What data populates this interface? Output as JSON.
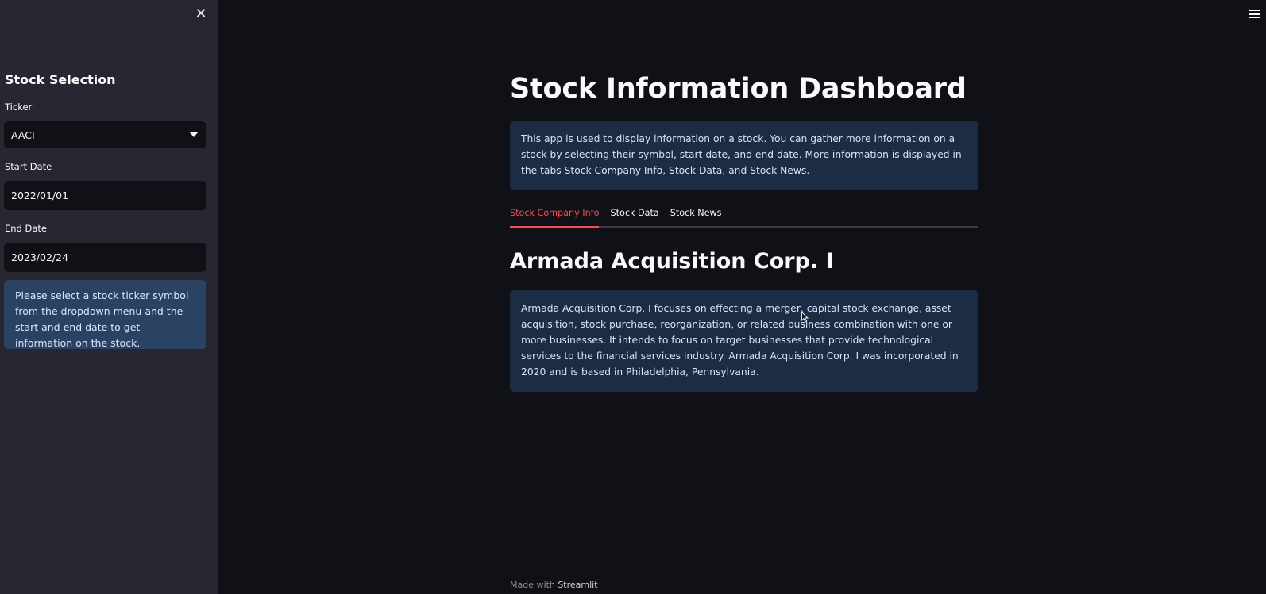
{
  "sidebar": {
    "title": "Stock Selection",
    "ticker_label": "Ticker",
    "ticker_value": "AACI",
    "start_label": "Start Date",
    "start_value": "2022/01/01",
    "end_label": "End Date",
    "end_value": "2023/02/24",
    "info": "Please select a stock ticker symbol from the dropdown menu and the start and end date to get information on the stock."
  },
  "main": {
    "title": "Stock Information Dashboard",
    "intro": "This app is used to display information on a stock. You can gather more information on a stock by selecting their symbol, start date, and end date. More information is displayed in the tabs Stock Company Info, Stock Data, and Stock News.",
    "tabs": [
      {
        "label": "Stock Company Info",
        "active": true
      },
      {
        "label": "Stock Data",
        "active": false
      },
      {
        "label": "Stock News",
        "active": false
      }
    ],
    "company_name": "Armada Acquisition Corp. I",
    "company_description": "Armada Acquisition Corp. I focuses on effecting a merger, capital stock exchange, asset acquisition, stock purchase, reorganization, or related business combination with one or more businesses. It intends to focus on target businesses that provide technological services to the financial services industry. Armada Acquisition Corp. I was incorporated in 2020 and is based in Philadelphia, Pennsylvania."
  },
  "footer": {
    "prefix": "Made with",
    "brand": "Streamlit"
  },
  "icons": {
    "close": "close-icon",
    "menu": "hamburger-menu-icon",
    "caret": "chevron-down-icon",
    "cursor": "mouse-cursor-icon"
  },
  "colors": {
    "accent": "#ff4b4b",
    "info_bg": "#1c2c44",
    "sidebar_bg": "#262730",
    "app_bg": "#0f1116"
  }
}
